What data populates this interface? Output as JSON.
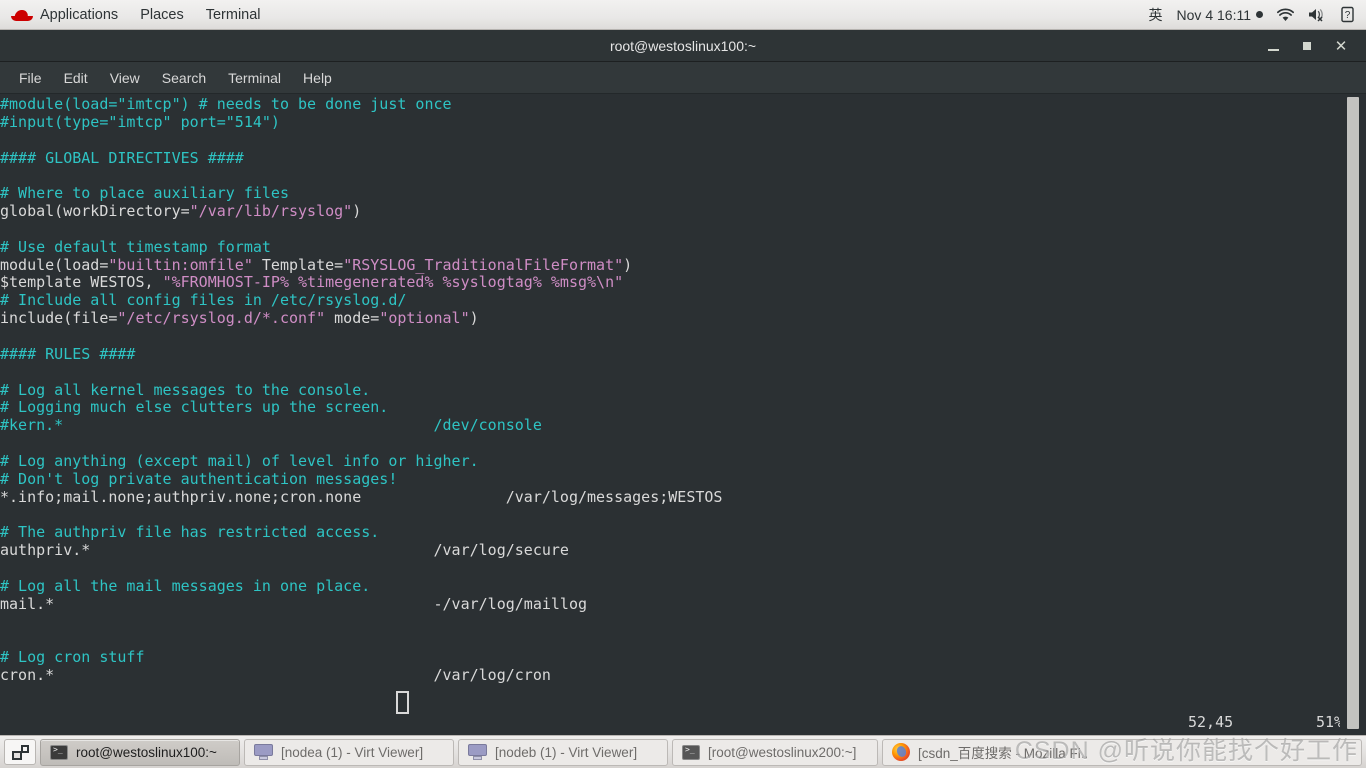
{
  "top_panel": {
    "logo_icon": "redhat-logo",
    "menus": [
      "Applications",
      "Places",
      "Terminal"
    ],
    "ime_indicator": "英",
    "clock": "Nov 4  16:11",
    "tray": [
      {
        "icon": "wifi-icon",
        "name": "network-wifi"
      },
      {
        "icon": "volume-muted-icon",
        "name": "volume-muted"
      },
      {
        "icon": "battery-unknown-icon",
        "name": "battery-status"
      }
    ]
  },
  "window": {
    "title": "root@westoslinux100:~",
    "buttons": {
      "minimize": "minimize",
      "maximize": "maximize",
      "close": "✕"
    },
    "menubar": [
      "File",
      "Edit",
      "View",
      "Search",
      "Terminal",
      "Help"
    ]
  },
  "terminal": {
    "lines": [
      [
        {
          "t": "#module(load=\"imtcp\") # needs to be done just once",
          "c": "comment"
        }
      ],
      [
        {
          "t": "#input(type=\"imtcp\" port=\"514\")",
          "c": "comment"
        }
      ],
      [
        {
          "t": "",
          "c": "plain"
        }
      ],
      [
        {
          "t": "#### GLOBAL DIRECTIVES ####",
          "c": "comment"
        }
      ],
      [
        {
          "t": "",
          "c": "plain"
        }
      ],
      [
        {
          "t": "# Where to place auxiliary files",
          "c": "comment"
        }
      ],
      [
        {
          "t": "global(workDirectory=",
          "c": "plain"
        },
        {
          "t": "\"/var/lib/rsyslog\"",
          "c": "string"
        },
        {
          "t": ")",
          "c": "plain"
        }
      ],
      [
        {
          "t": "",
          "c": "plain"
        }
      ],
      [
        {
          "t": "# Use default timestamp format",
          "c": "comment"
        }
      ],
      [
        {
          "t": "module(load=",
          "c": "plain"
        },
        {
          "t": "\"builtin:omfile\"",
          "c": "string"
        },
        {
          "t": " Template=",
          "c": "plain"
        },
        {
          "t": "\"RSYSLOG_TraditionalFileFormat\"",
          "c": "string"
        },
        {
          "t": ")",
          "c": "plain"
        }
      ],
      [
        {
          "t": "$template WESTOS, ",
          "c": "plain"
        },
        {
          "t": "\"%FROMHOST-IP% %timegenerated% %syslogtag% %msg%\\n\"",
          "c": "string"
        }
      ],
      [
        {
          "t": "# Include all config files in /etc/rsyslog.d/",
          "c": "comment"
        }
      ],
      [
        {
          "t": "include(file=",
          "c": "plain"
        },
        {
          "t": "\"/etc/rsyslog.d/*.conf\"",
          "c": "string"
        },
        {
          "t": " mode=",
          "c": "plain"
        },
        {
          "t": "\"optional\"",
          "c": "string"
        },
        {
          "t": ")",
          "c": "plain"
        }
      ],
      [
        {
          "t": "",
          "c": "plain"
        }
      ],
      [
        {
          "t": "#### RULES ####",
          "c": "comment"
        }
      ],
      [
        {
          "t": "",
          "c": "plain"
        }
      ],
      [
        {
          "t": "# Log all kernel messages to the console.",
          "c": "comment"
        }
      ],
      [
        {
          "t": "# Logging much else clutters up the screen.",
          "c": "comment"
        }
      ],
      [
        {
          "t": "#kern.*                                         /dev/console",
          "c": "comment"
        }
      ],
      [
        {
          "t": "",
          "c": "plain"
        }
      ],
      [
        {
          "t": "# Log anything (except mail) of level info or higher.",
          "c": "comment"
        }
      ],
      [
        {
          "t": "# Don't log private authentication messages!",
          "c": "comment"
        }
      ],
      [
        {
          "t": "*.info;mail.none;authpriv.none;cron.none                /var/log/messages;WESTOS",
          "c": "plain"
        }
      ],
      [
        {
          "t": "",
          "c": "plain"
        }
      ],
      [
        {
          "t": "# The authpriv file has restricted access.",
          "c": "comment"
        }
      ],
      [
        {
          "t": "authpriv.*                                      /var/log/secure",
          "c": "plain"
        }
      ],
      [
        {
          "t": "",
          "c": "plain"
        }
      ],
      [
        {
          "t": "# Log all the mail messages in one place.",
          "c": "comment"
        }
      ],
      [
        {
          "t": "mail.*                                          -/var/log/maillog",
          "c": "plain"
        }
      ],
      [
        {
          "t": "",
          "c": "plain"
        }
      ],
      [
        {
          "t": "",
          "c": "plain"
        }
      ],
      [
        {
          "t": "# Log cron stuff",
          "c": "comment"
        }
      ],
      [
        {
          "t": "cron.*                                          /var/log/cron",
          "c": "plain"
        }
      ]
    ],
    "status": {
      "position": "52,45",
      "percent": "51%"
    },
    "colors": {
      "background": "#2b3033",
      "comment": "#2ec4c4",
      "string": "#cf8dc5",
      "plain": "#d9d9d9"
    }
  },
  "taskbar": {
    "switcher_icon": "window-switcher-icon",
    "tasks": [
      {
        "label": "root@westoslinux100:~",
        "icon": "terminal-icon",
        "active": true
      },
      {
        "label": "[nodea (1) - Virt Viewer]",
        "icon": "monitor-icon",
        "active": false
      },
      {
        "label": "[nodeb (1) - Virt Viewer]",
        "icon": "monitor-icon",
        "active": false
      },
      {
        "label": "[root@westoslinux200:~]",
        "icon": "terminal-icon",
        "active": false
      },
      {
        "label": "[csdn_百度搜索 - Mozilla Fi..",
        "icon": "firefox-icon",
        "active": false
      }
    ]
  },
  "watermark": {
    "text": "CSDN @听说你能找个好工作"
  }
}
